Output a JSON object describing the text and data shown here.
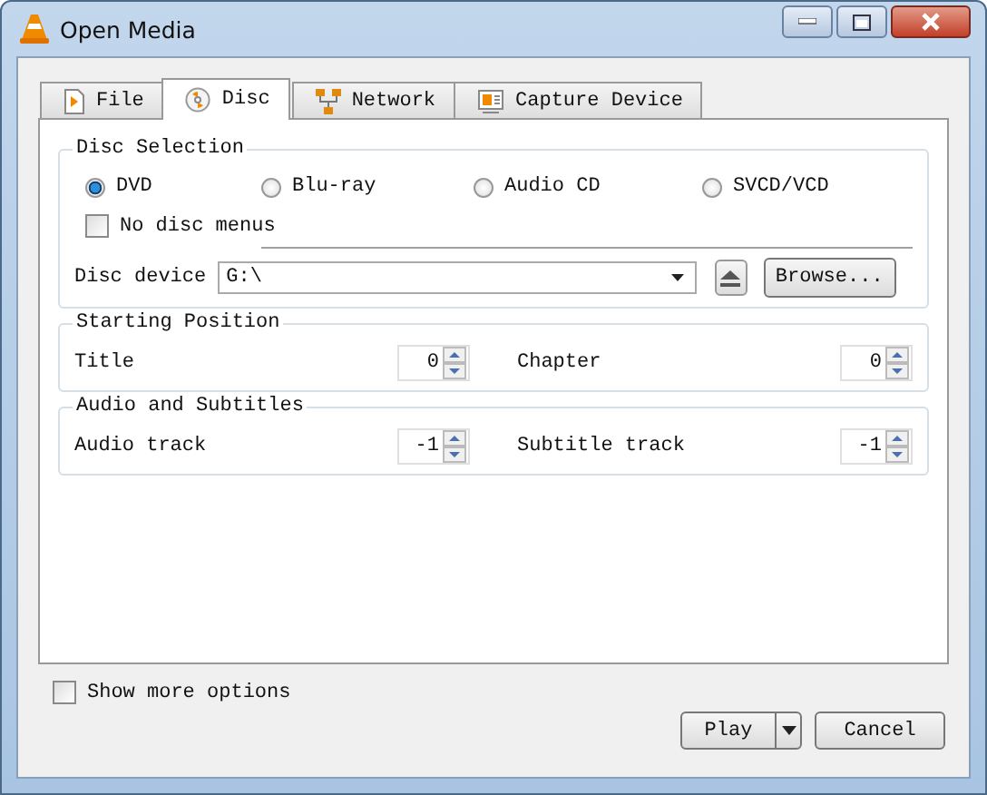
{
  "window": {
    "title": "Open Media"
  },
  "tabs": [
    {
      "label": "File",
      "kind": "file",
      "selected": false
    },
    {
      "label": "Disc",
      "kind": "disc",
      "selected": true
    },
    {
      "label": "Network",
      "kind": "network",
      "selected": false
    },
    {
      "label": "Capture Device",
      "kind": "capture",
      "selected": false
    }
  ],
  "disc_selection": {
    "title": "Disc Selection",
    "options": [
      {
        "label": "DVD",
        "selected": true
      },
      {
        "label": "Blu-ray",
        "selected": false
      },
      {
        "label": "Audio CD",
        "selected": false
      },
      {
        "label": "SVCD/VCD",
        "selected": false
      }
    ],
    "no_disc_menus": {
      "label": "No disc menus",
      "checked": false
    },
    "disc_device": {
      "label": "Disc device",
      "value": "G:\\"
    },
    "browse_button": "Browse..."
  },
  "starting_position": {
    "title": "Starting Position",
    "fields": [
      {
        "label": "Title",
        "value": "0"
      },
      {
        "label": "Chapter",
        "value": "0"
      }
    ]
  },
  "audio_subtitles": {
    "title": "Audio and Subtitles",
    "fields": [
      {
        "label": "Audio track",
        "value": "-1"
      },
      {
        "label": "Subtitle track",
        "value": "-1"
      }
    ]
  },
  "show_more_options": {
    "label": "Show more options",
    "checked": false
  },
  "buttons": {
    "play": "Play",
    "cancel": "Cancel"
  }
}
